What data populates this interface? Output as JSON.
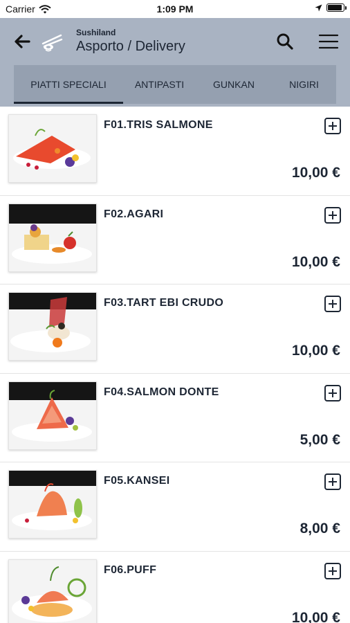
{
  "status_bar": {
    "carrier": "Carrier",
    "time": "1:09 PM",
    "battery_level": 0.95
  },
  "header": {
    "brand": "Sushiland",
    "title": "Asporto / Delivery"
  },
  "icons": {
    "back": "arrow-left-icon",
    "logo": "chopsticks-logo",
    "search": "search-icon",
    "menu": "hamburger-menu-icon",
    "add": "plus-square-icon",
    "wifi": "wifi-icon",
    "location": "location-arrow-icon",
    "battery": "battery-icon"
  },
  "colors": {
    "header_bg": "#a9b3c2",
    "tab_bg": "#95a0b0",
    "text_dark": "#1d2634"
  },
  "tabs": [
    {
      "label": "PIATTI SPECIALI",
      "active": true
    },
    {
      "label": "ANTIPASTI",
      "active": false
    },
    {
      "label": "GUNKAN",
      "active": false
    },
    {
      "label": "NIGIRI",
      "active": false
    }
  ],
  "items": [
    {
      "name": "F01.TRIS SALMONE",
      "price": "10,00 €"
    },
    {
      "name": "F02.AGARI",
      "price": "10,00 €"
    },
    {
      "name": "F03.TART EBI CRUDO",
      "price": "10,00 €"
    },
    {
      "name": "F04.SALMON DONTE",
      "price": "5,00 €"
    },
    {
      "name": "F05.KANSEI",
      "price": "8,00 €"
    },
    {
      "name": "F06.PUFF",
      "price": "10,00 €"
    }
  ]
}
